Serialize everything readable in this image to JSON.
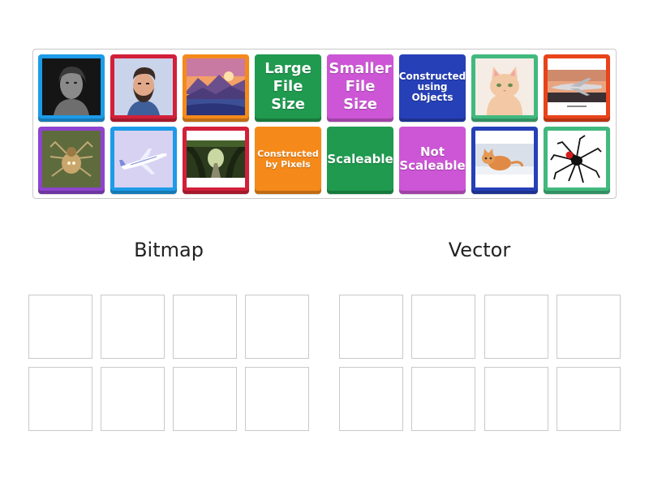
{
  "tiles": {
    "large_file_size": "Large File Size",
    "smaller_file_size": "Smaller File Size",
    "constructed_using_objects": "Constructed using Objects",
    "constructed_by_pixels": "Constructed by Pixels",
    "scaleable": "Scaleable",
    "not_scaleable": "Not Scaleable"
  },
  "image_tiles": [
    "woman-portrait-photo",
    "man-beard-illustration",
    "mountain-lake-sunset-illustration",
    "cat-illustration",
    "airplane-runway-photo",
    "spider-photo",
    "airplane-illustration",
    "tree-tunnel-road-photo",
    "kitten-photo",
    "spider-illustration"
  ],
  "groups": {
    "bitmap": "Bitmap",
    "vector": "Vector"
  },
  "colors": {
    "blue": "#1d9be8",
    "red": "#d2203a",
    "orange": "#f58a1a",
    "green": "#1f9a4f",
    "magenta": "#cc56d5",
    "navy": "#2640b8",
    "mint": "#41b97e",
    "redorange": "#e8431a",
    "purple": "#8e44ce"
  }
}
